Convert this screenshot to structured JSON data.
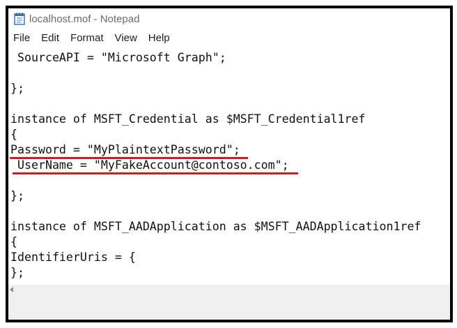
{
  "window": {
    "title": "localhost.mof - Notepad",
    "icon": "notepad-icon"
  },
  "menu": {
    "file": "File",
    "edit": "Edit",
    "format": "Format",
    "view": "View",
    "help": "Help"
  },
  "editor": {
    "lines": [
      " SourceAPI = \"Microsoft Graph\";",
      "",
      "};",
      "",
      "instance of MSFT_Credential as $MSFT_Credential1ref",
      "{",
      "Password = \"MyPlaintextPassword\";",
      " UserName = \"MyFakeAccount@contoso.com\";",
      "",
      "};",
      "",
      "instance of MSFT_AADApplication as $MSFT_AADApplication1ref",
      "{",
      "IdentifierUris = {",
      "};"
    ]
  },
  "colors": {
    "highlight_underline": "#d11a1a",
    "frame": "#000000"
  }
}
